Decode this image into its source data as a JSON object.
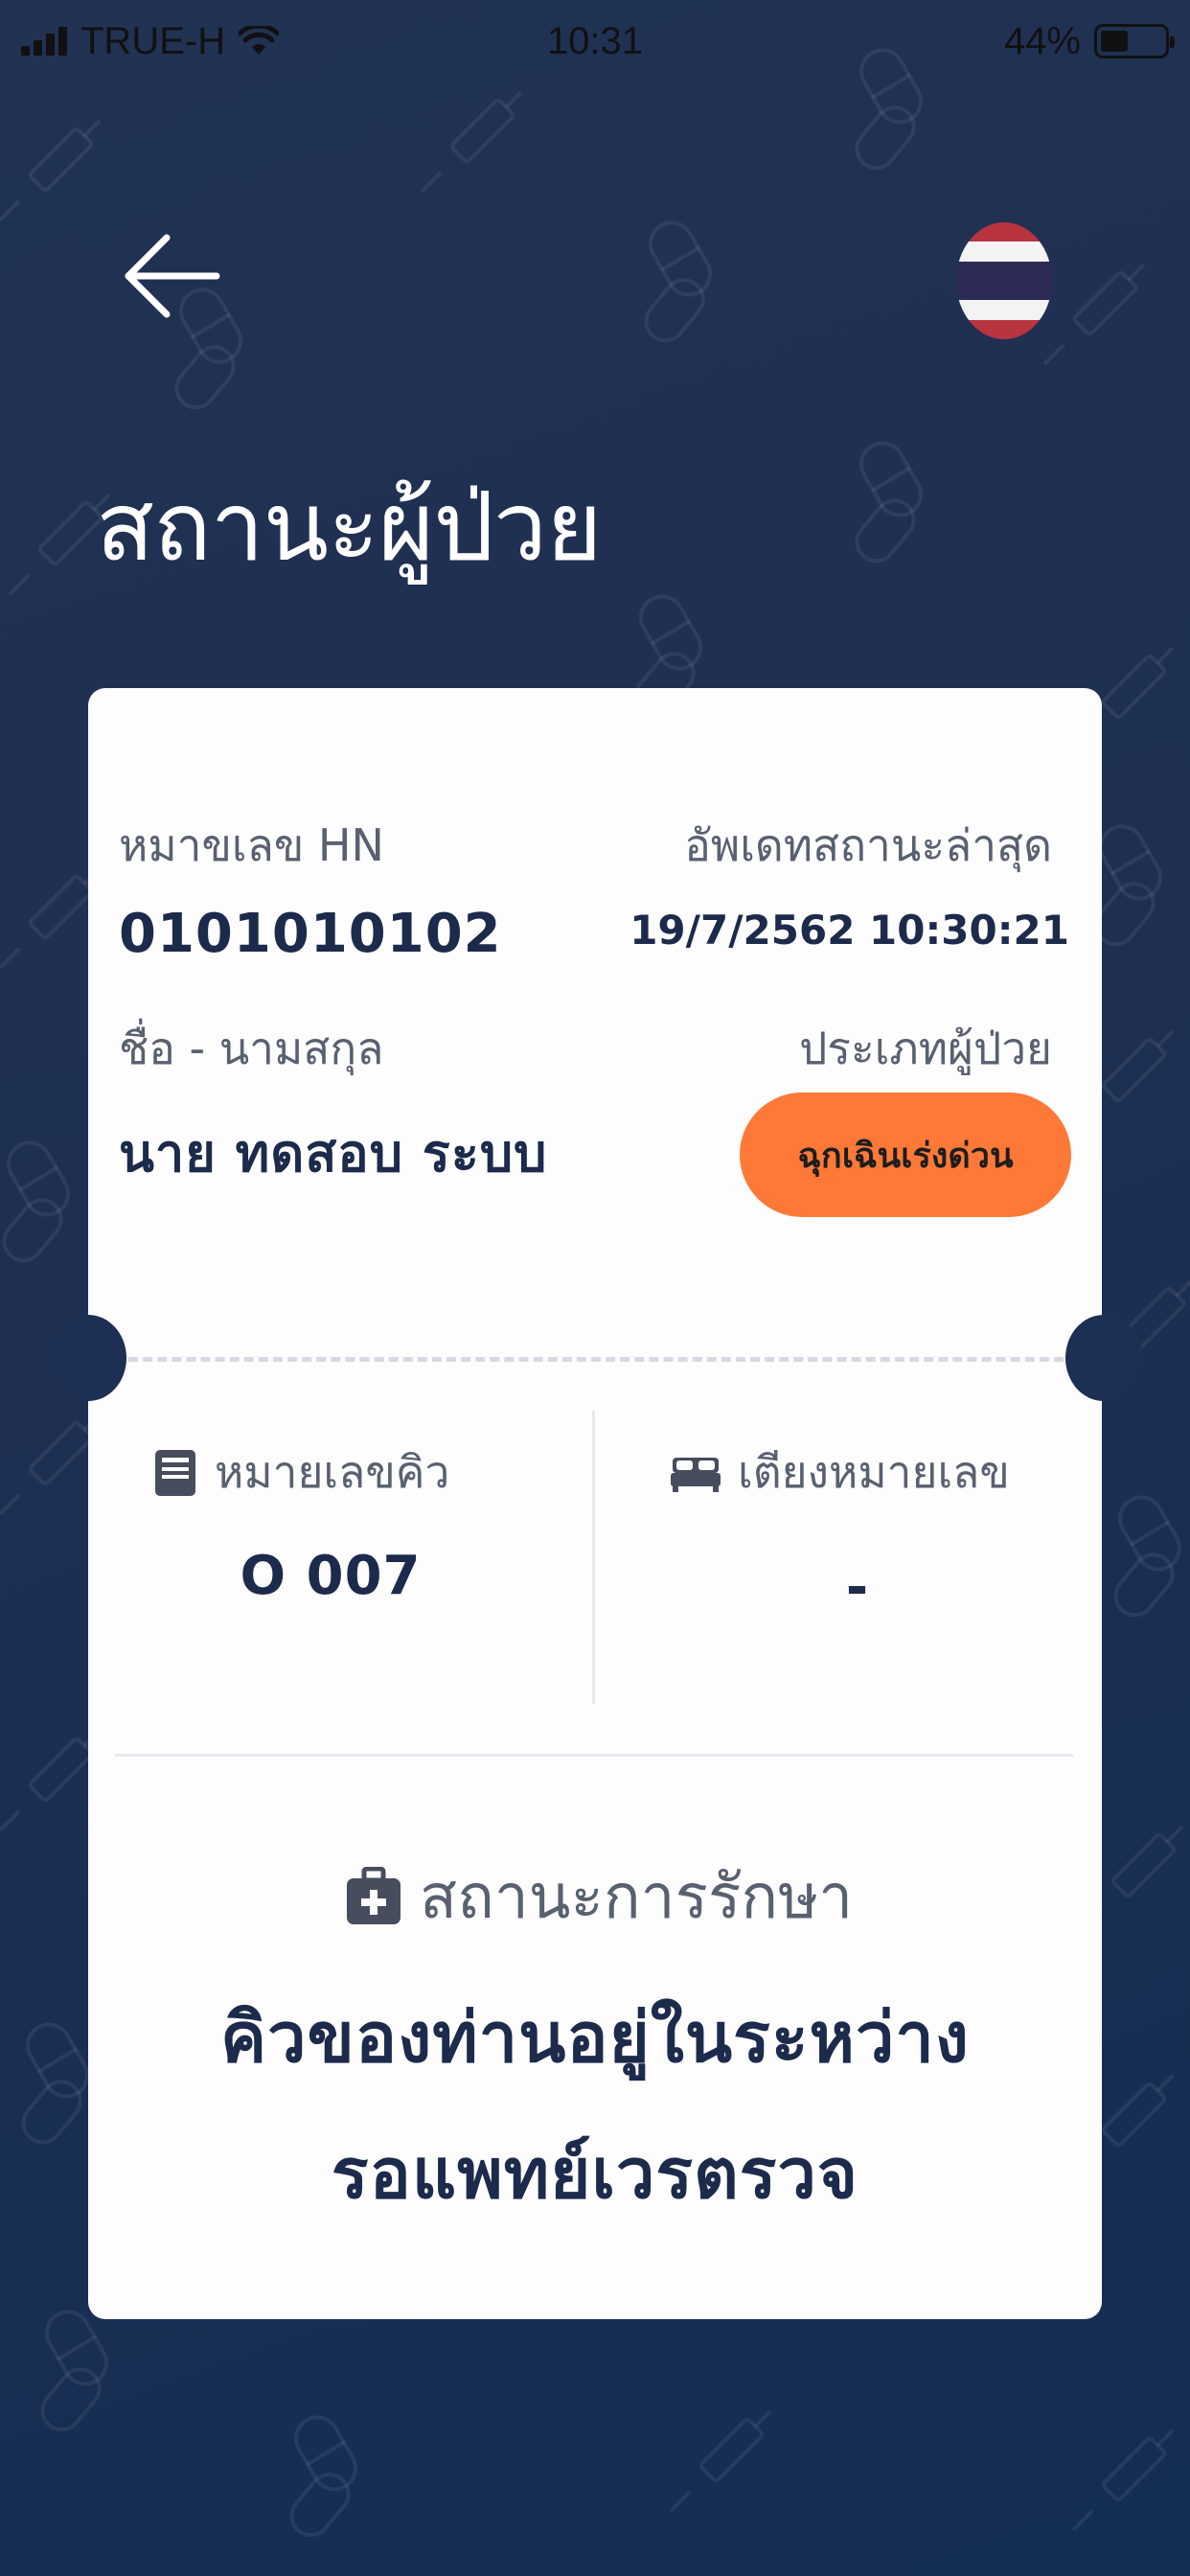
{
  "status_bar": {
    "carrier": "TRUE-H",
    "time": "10:31",
    "battery_percent": "44%",
    "battery_level": 0.44
  },
  "header": {
    "back_icon": "arrow-left-icon",
    "language_icon": "thai-flag-icon",
    "title": "สถานะผู้ป่วย"
  },
  "patient": {
    "hn_label": "หมาขเลข HN",
    "hn_value": "0101010102",
    "updated_label": "อัพเดทสถานะล่าสุด",
    "updated_value": "19/7/2562 10:30:21",
    "name_label": "ชื่อ - นามสกุล",
    "name_value": "นาย ทดสอบ ระบบ",
    "type_label": "ประเภทผู้ป่วย",
    "type_value": "ฉุกเฉินเร่งด่วน"
  },
  "queue": {
    "queue_icon": "document-icon",
    "queue_label": "หมายเลขคิว",
    "queue_value": "O 007",
    "bed_icon": "bed-icon",
    "bed_label": "เตียงหมายเลข",
    "bed_value": "-"
  },
  "treatment": {
    "icon": "medical-bag-icon",
    "label": "สถานะการรักษา",
    "line1": "คิวของท่านอยู่ในระหว่าง",
    "line2": "รอแพทย์เวรตรวจ"
  },
  "colors": {
    "background": "#1f3052",
    "card": "#fdfdfd",
    "text_dark": "#1c2a4c",
    "badge": "#fe7938"
  }
}
